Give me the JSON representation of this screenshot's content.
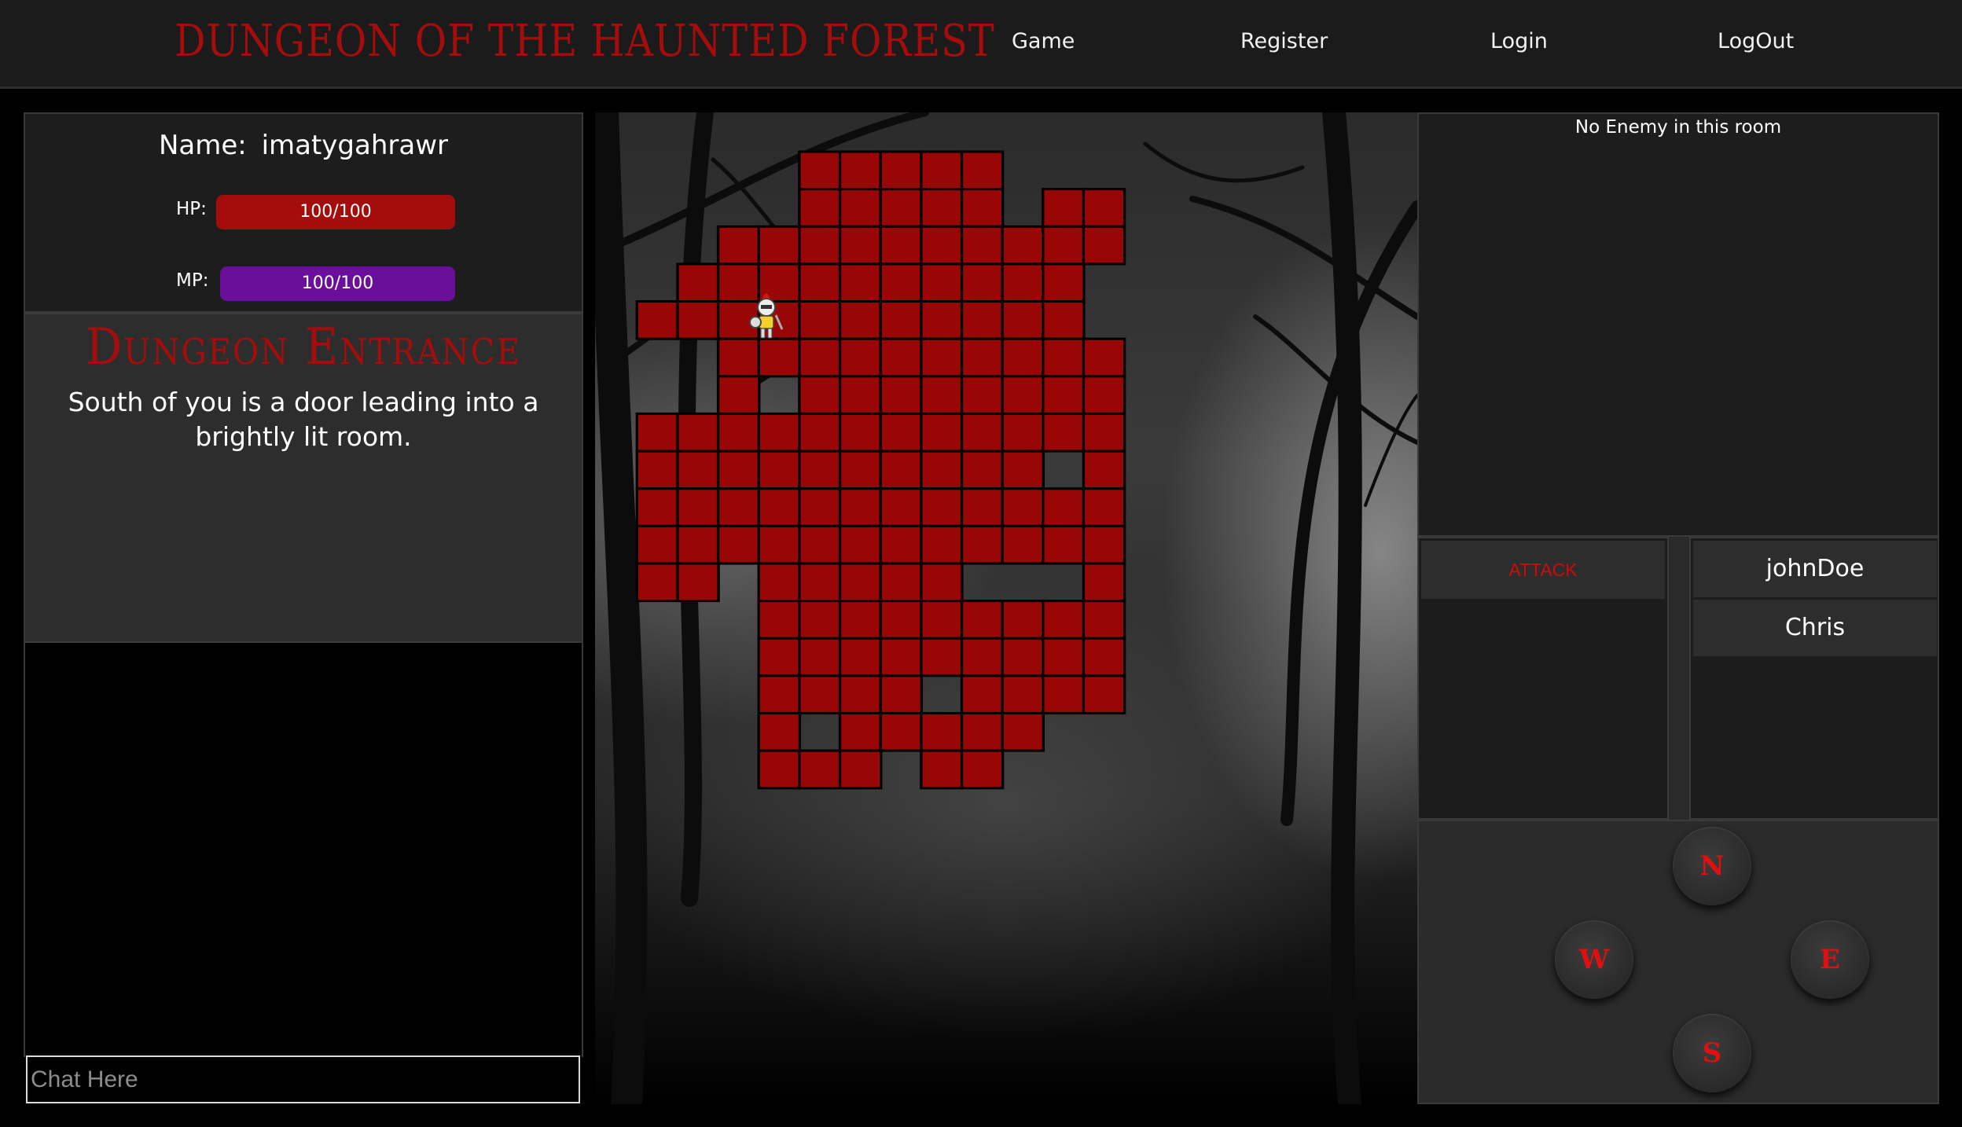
{
  "header": {
    "title": "DUNGEON OF THE HAUNTED FOREST",
    "nav": [
      "Game",
      "Register",
      "Login",
      "LogOut"
    ]
  },
  "player": {
    "name_label": "Name:",
    "name": "imatygahrawr",
    "hp_label": "HP:",
    "hp_text": "100/100",
    "hp_fraction": 1.0,
    "mp_label": "MP:",
    "mp_text": "100/100",
    "mp_fraction": 1.0
  },
  "room": {
    "title": "Dungeon Entrance",
    "description": "South of you is a door leading into a brightly lit room."
  },
  "chat": {
    "placeholder": "Chat Here"
  },
  "enemy": {
    "status": "No Enemy in this room"
  },
  "actions": {
    "attack_label": "ATTACK"
  },
  "players_in_room": [
    "johnDoe",
    "Chris"
  ],
  "directions": {
    "north": "N",
    "west": "W",
    "east": "E",
    "south": "S"
  },
  "colors": {
    "title_red": "#a50d0d",
    "room_red": "#980606",
    "hp_bar": "#a50d0d",
    "mp_bar": "#6a0f9a",
    "direction_letter": "#e01010"
  },
  "icons": {
    "player_marker": "knight-icon"
  }
}
